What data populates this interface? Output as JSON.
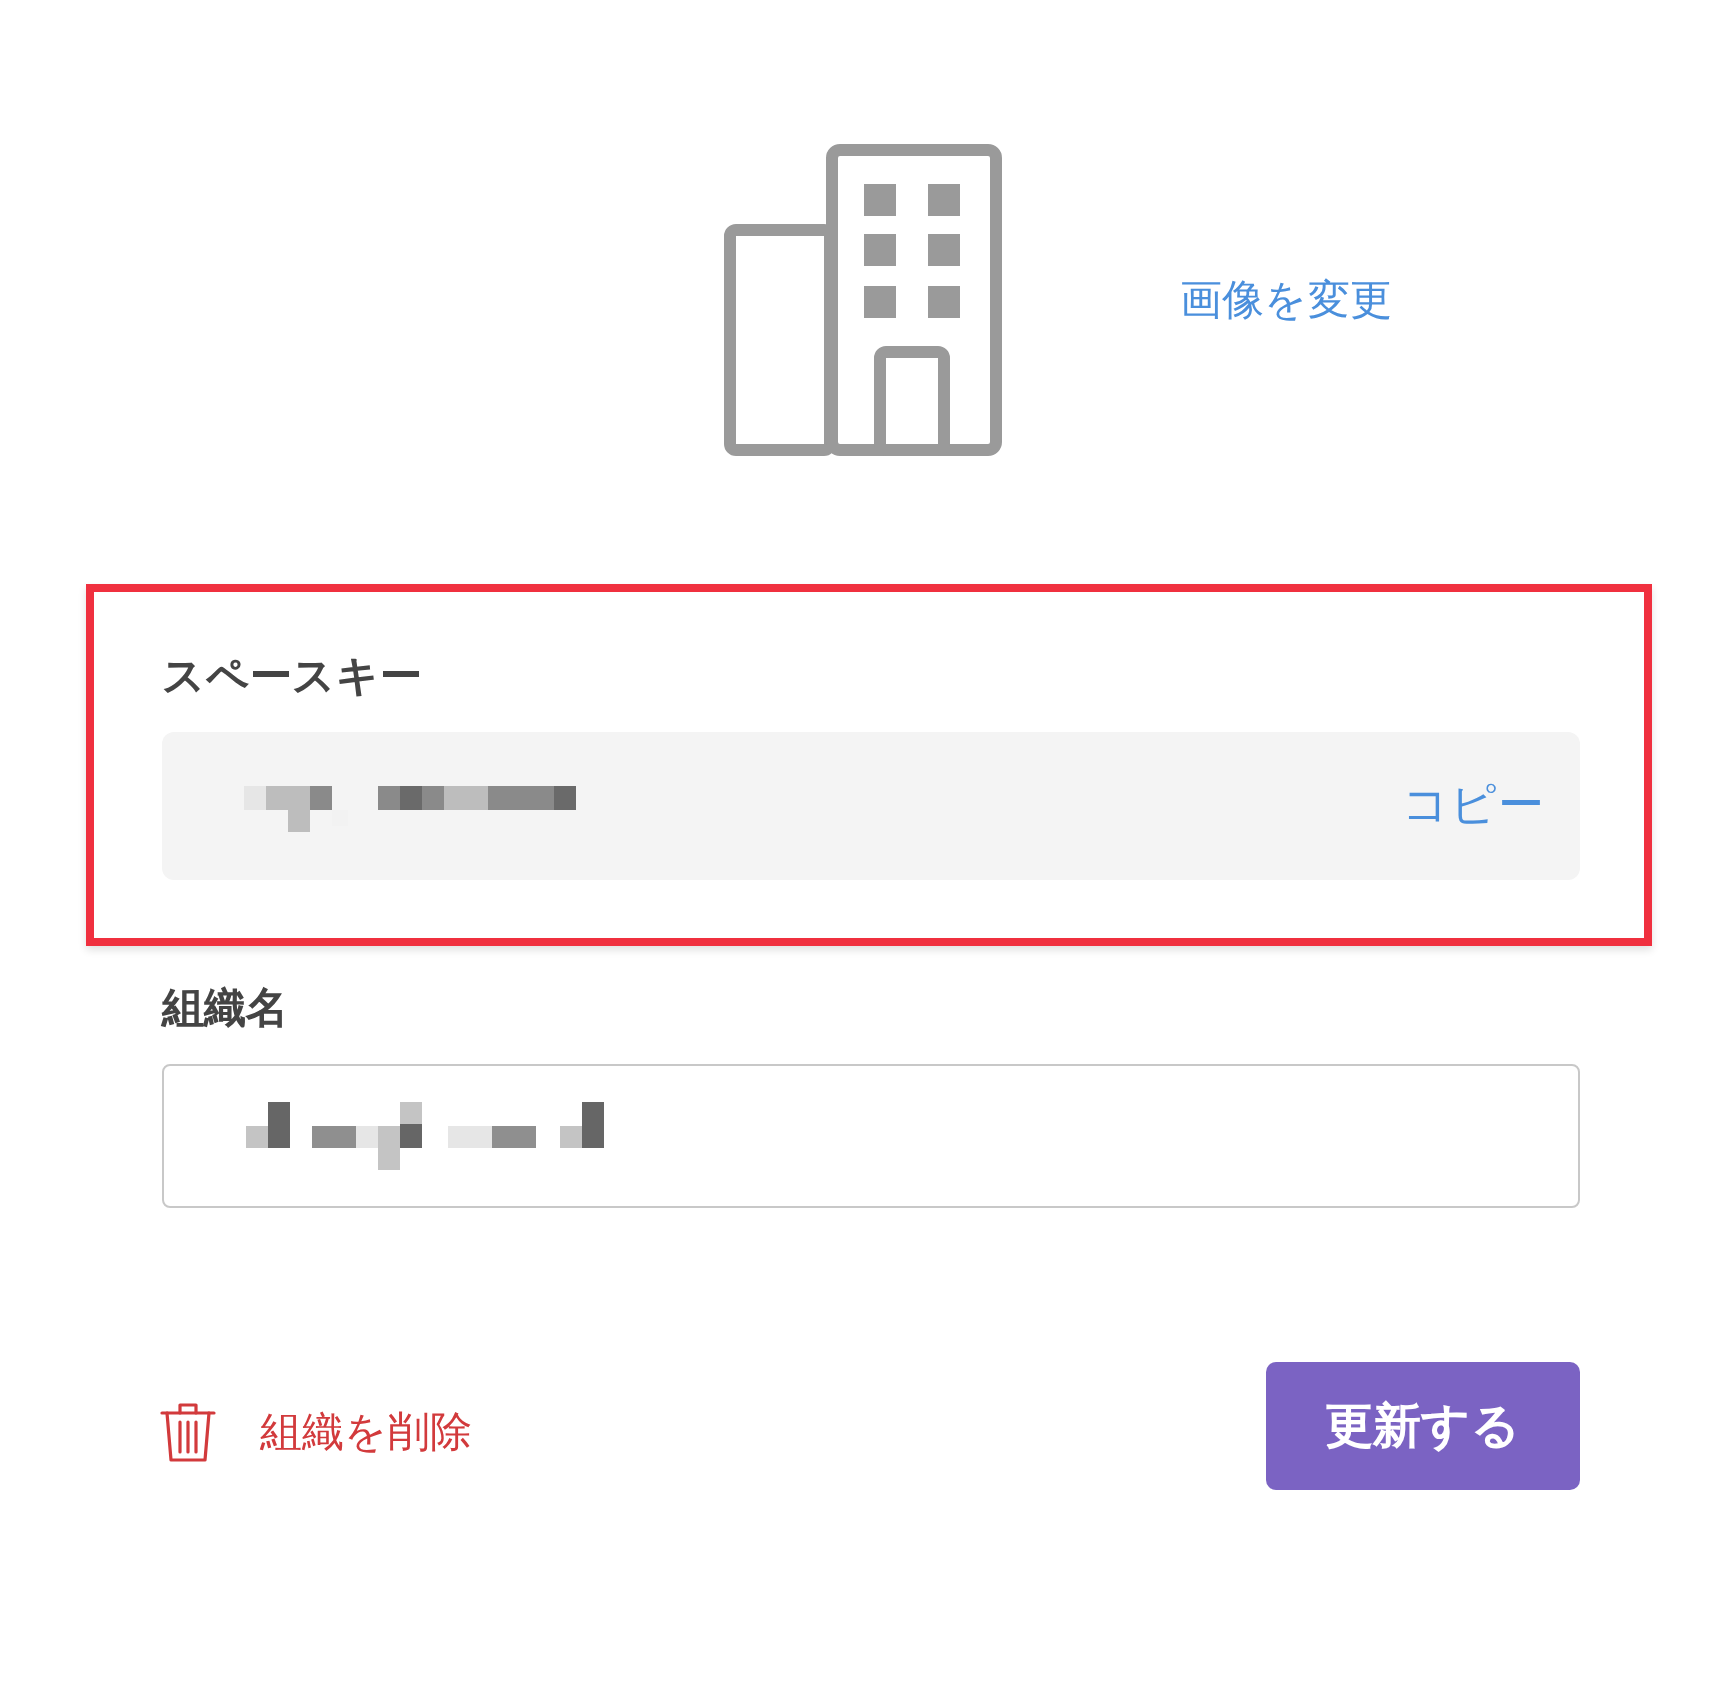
{
  "logo": {
    "change_link": "画像を変更"
  },
  "space_key": {
    "label": "スペースキー",
    "copy_link": "コピー",
    "highlighted": true
  },
  "organization_name": {
    "label": "組織名"
  },
  "actions": {
    "delete_link": "組織を削除",
    "submit_button": "更新する"
  }
}
